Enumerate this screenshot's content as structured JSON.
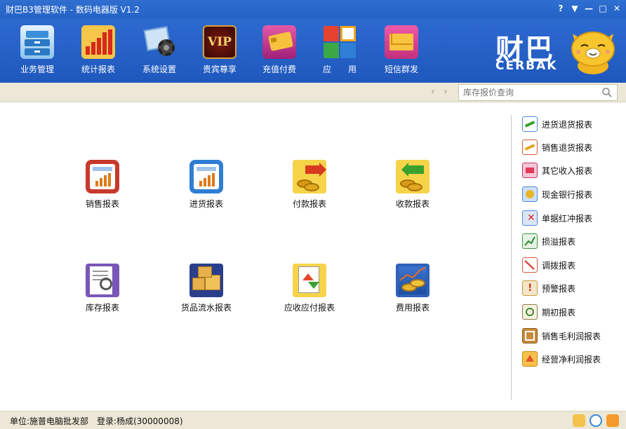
{
  "window": {
    "title": "财巴B3管理软件 - 数码电器版 V1.2",
    "buttons": [
      "?",
      "▼",
      "—",
      "□",
      "✕"
    ]
  },
  "toolbar": {
    "items": [
      {
        "label": "业务管理",
        "icon": "cabinet-icon"
      },
      {
        "label": "统计报表",
        "icon": "chart-icon"
      },
      {
        "label": "系统设置",
        "icon": "gear-icon"
      },
      {
        "label": "贵宾尊享",
        "icon": "vip-icon"
      },
      {
        "label": "充值付费",
        "icon": "card-icon"
      },
      {
        "label": "应　　用",
        "icon": "apps-icon"
      },
      {
        "label": "短信群发",
        "icon": "envelope-icon"
      }
    ]
  },
  "brand": {
    "cn": "财巴",
    "en": "CERBAK"
  },
  "search": {
    "placeholder": "库存报价查询"
  },
  "reports": [
    {
      "label": "销售报表",
      "icon": "sales-report-icon"
    },
    {
      "label": "进货报表",
      "icon": "purchase-report-icon"
    },
    {
      "label": "付款报表",
      "icon": "payment-report-icon"
    },
    {
      "label": "收款报表",
      "icon": "receipt-report-icon"
    },
    {
      "label": "库存报表",
      "icon": "inventory-report-icon"
    },
    {
      "label": "货品流水报表",
      "icon": "goods-flow-report-icon"
    },
    {
      "label": "应收应付报表",
      "icon": "receivable-payable-report-icon"
    },
    {
      "label": "费用报表",
      "icon": "expense-report-icon"
    }
  ],
  "sidebar": {
    "items": [
      {
        "label": "进货退货报表",
        "icon": "purchase-return-icon"
      },
      {
        "label": "销售退货报表",
        "icon": "sales-return-icon"
      },
      {
        "label": "其它收入报表",
        "icon": "other-income-icon"
      },
      {
        "label": "现金银行报表",
        "icon": "cash-bank-icon"
      },
      {
        "label": "单据红冲报表",
        "icon": "red-reversal-icon"
      },
      {
        "label": "损溢报表",
        "icon": "profit-loss-icon"
      },
      {
        "label": "调拨报表",
        "icon": "transfer-icon"
      },
      {
        "label": "预警报表",
        "icon": "warning-icon"
      },
      {
        "label": "期初报表",
        "icon": "opening-icon"
      },
      {
        "label": "销售毛利润报表",
        "icon": "gross-profit-icon"
      },
      {
        "label": "经营净利润报表",
        "icon": "net-profit-icon"
      }
    ]
  },
  "status": {
    "text": "单位:施普电脑批发部　登录:杨成(30000008)"
  },
  "colors": {
    "title_bar": "#2563c7",
    "nav_bar": "#ece7d6",
    "accent_orange": "#f59a12"
  }
}
